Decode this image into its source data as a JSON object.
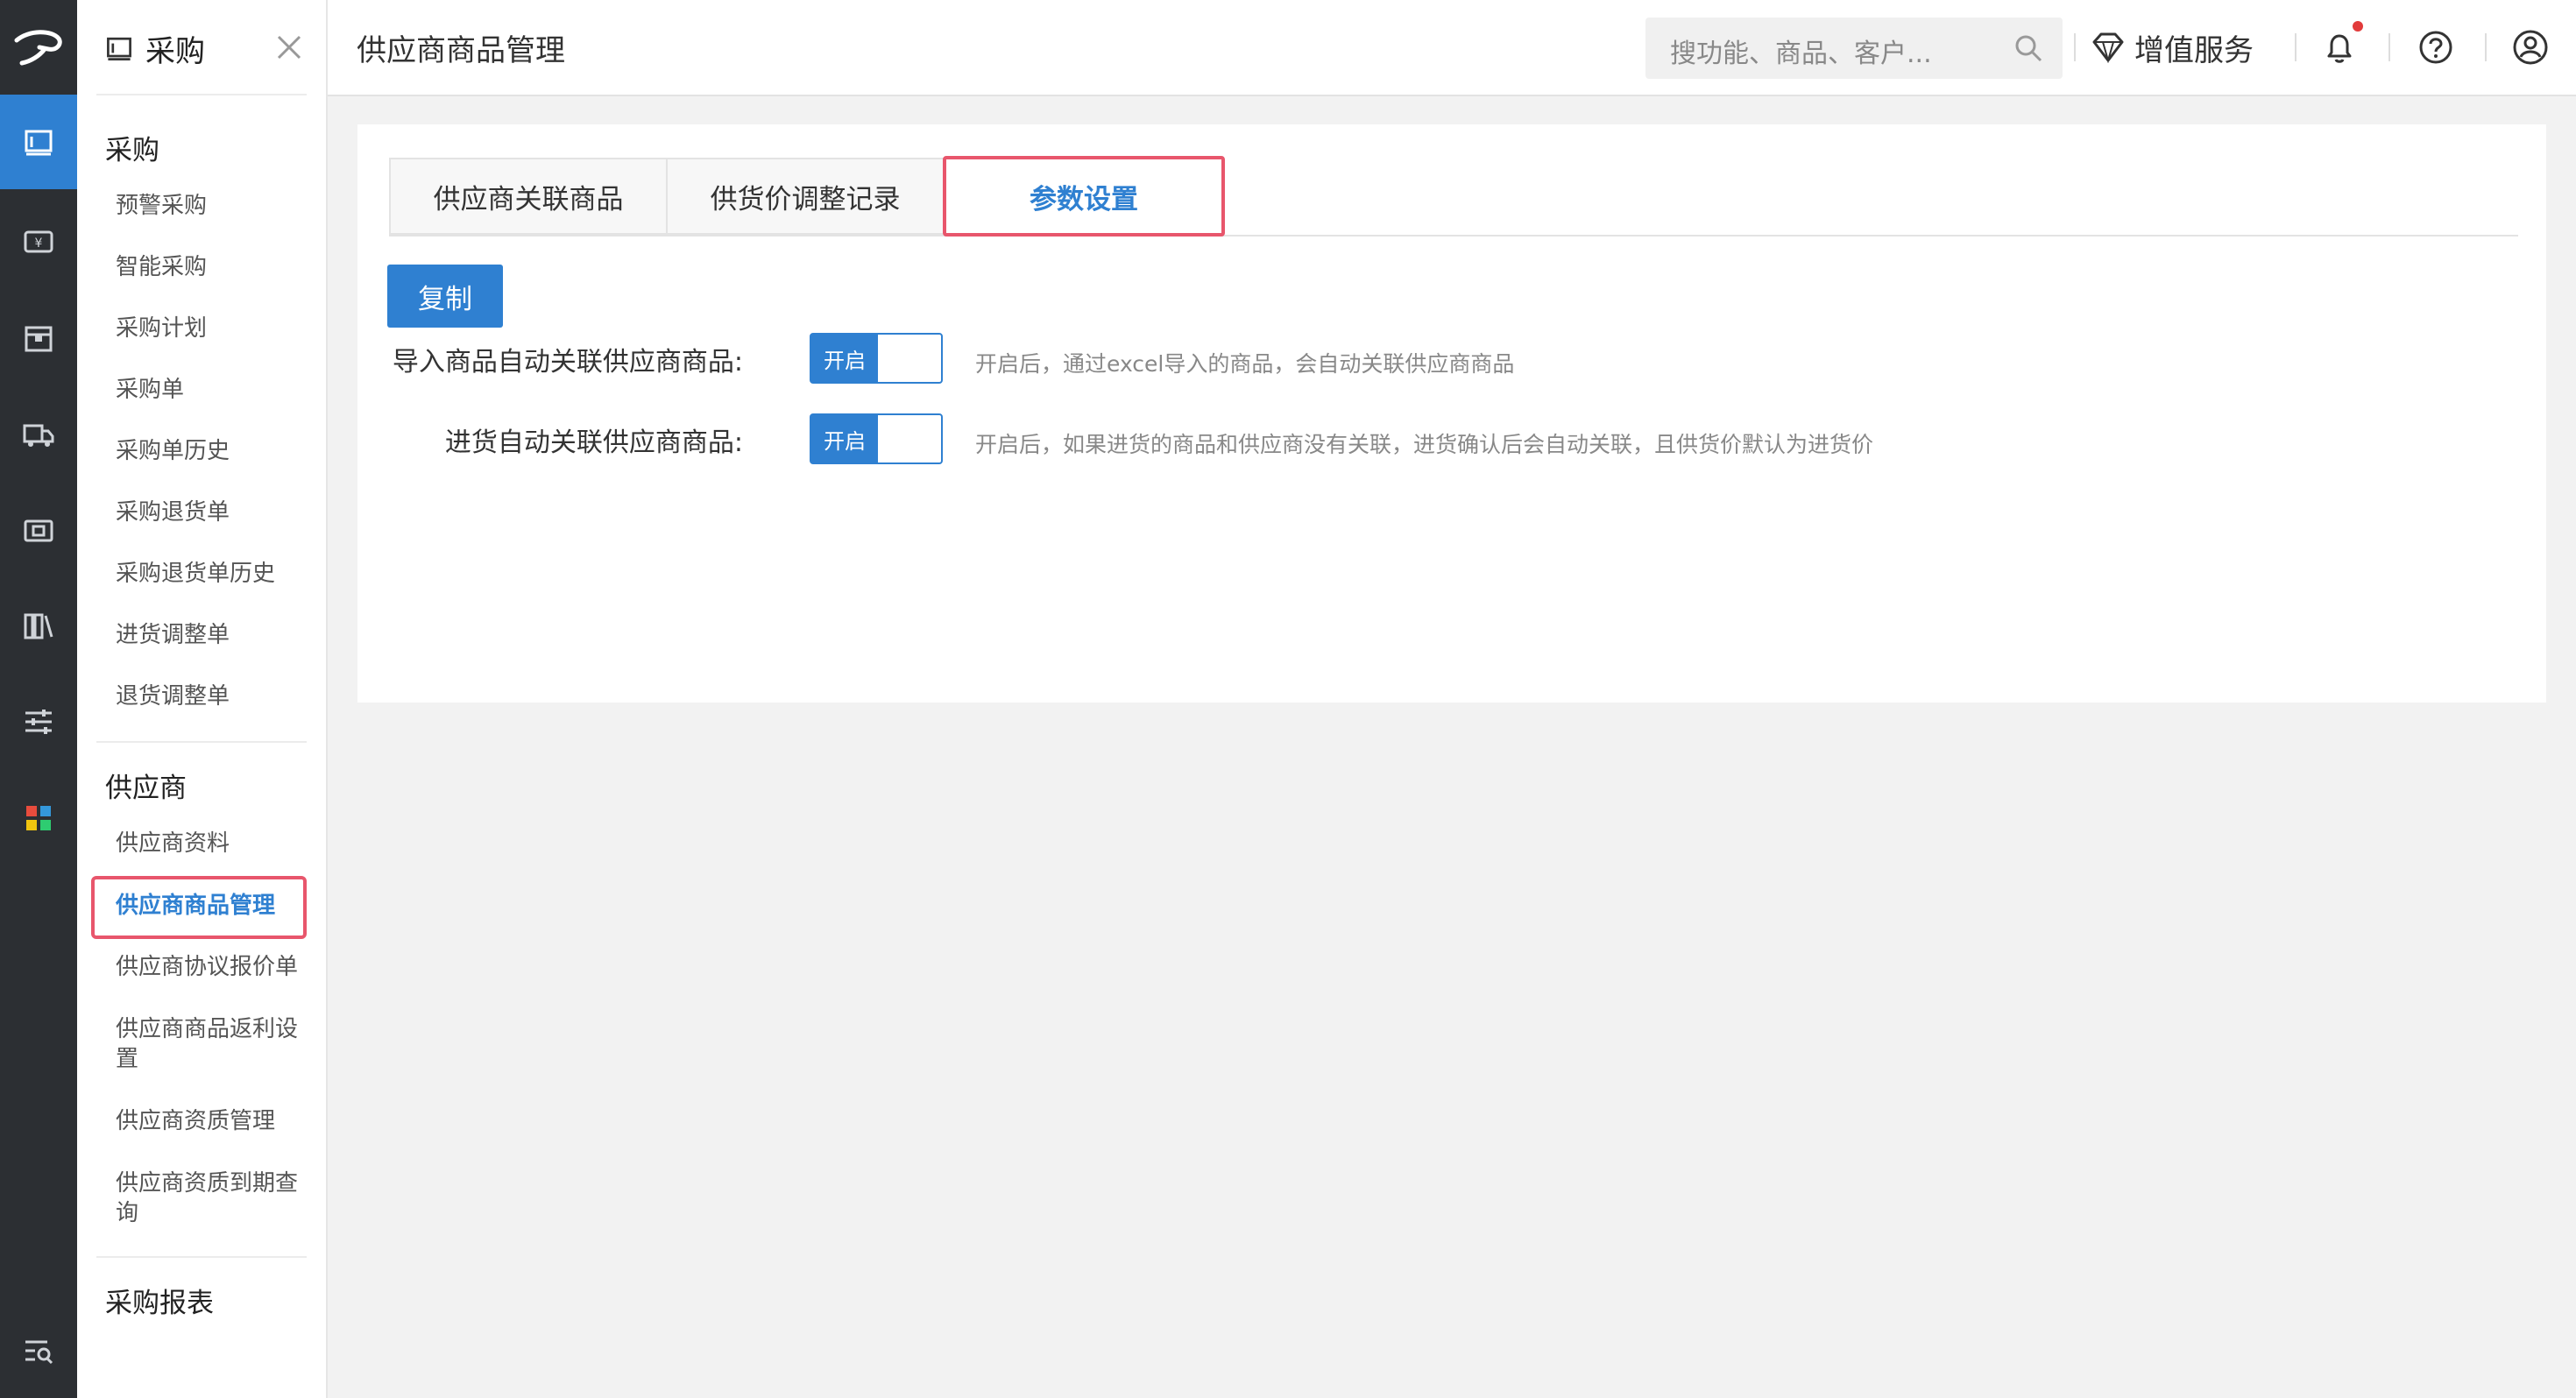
{
  "menu": {
    "title": "采购",
    "groups": [
      {
        "label": "采购",
        "items": [
          "预警采购",
          "智能采购",
          "采购计划",
          "采购单",
          "采购单历史",
          "采购退货单",
          "采购退货单历史",
          "进货调整单",
          "退货调整单"
        ]
      },
      {
        "label": "供应商",
        "items": [
          "供应商资料",
          "供应商商品管理",
          "供应商协议报价单",
          "供应商商品返利设置",
          "供应商资质管理",
          "供应商资质到期查询"
        ]
      },
      {
        "label": "采购报表",
        "items": []
      }
    ],
    "active_item": "供应商商品管理"
  },
  "topbar": {
    "title": "供应商商品管理",
    "search_placeholder": "搜功能、商品、客户...",
    "value_added_label": "增值服务"
  },
  "tabs": [
    {
      "label": "供应商关联商品",
      "active": false
    },
    {
      "label": "供货价调整记录",
      "active": false
    },
    {
      "label": "参数设置",
      "active": true
    }
  ],
  "copy_button": "复制",
  "settings": [
    {
      "label": "导入商品自动关联供应商商品:",
      "toggle": "开启",
      "hint": "开启后，通过excel导入的商品，会自动关联供应商商品"
    },
    {
      "label": "进货自动关联供应商商品:",
      "toggle": "开启",
      "hint": "开启后，如果进货的商品和供应商没有关联，进货确认后会自动关联，且供货价默认为进货价"
    }
  ],
  "colors": {
    "accent": "#2f80d1",
    "highlight": "#e8566c",
    "rail": "#2c2f33"
  },
  "icons": [
    "logo-icon",
    "purchase-icon",
    "finance-icon",
    "inventory-icon",
    "delivery-icon",
    "pos-icon",
    "reports-icon",
    "settings-sliders-icon",
    "apps-grid-icon",
    "menu-search-icon",
    "close-icon",
    "search-icon",
    "diamond-icon",
    "bell-icon",
    "help-icon",
    "user-icon"
  ]
}
